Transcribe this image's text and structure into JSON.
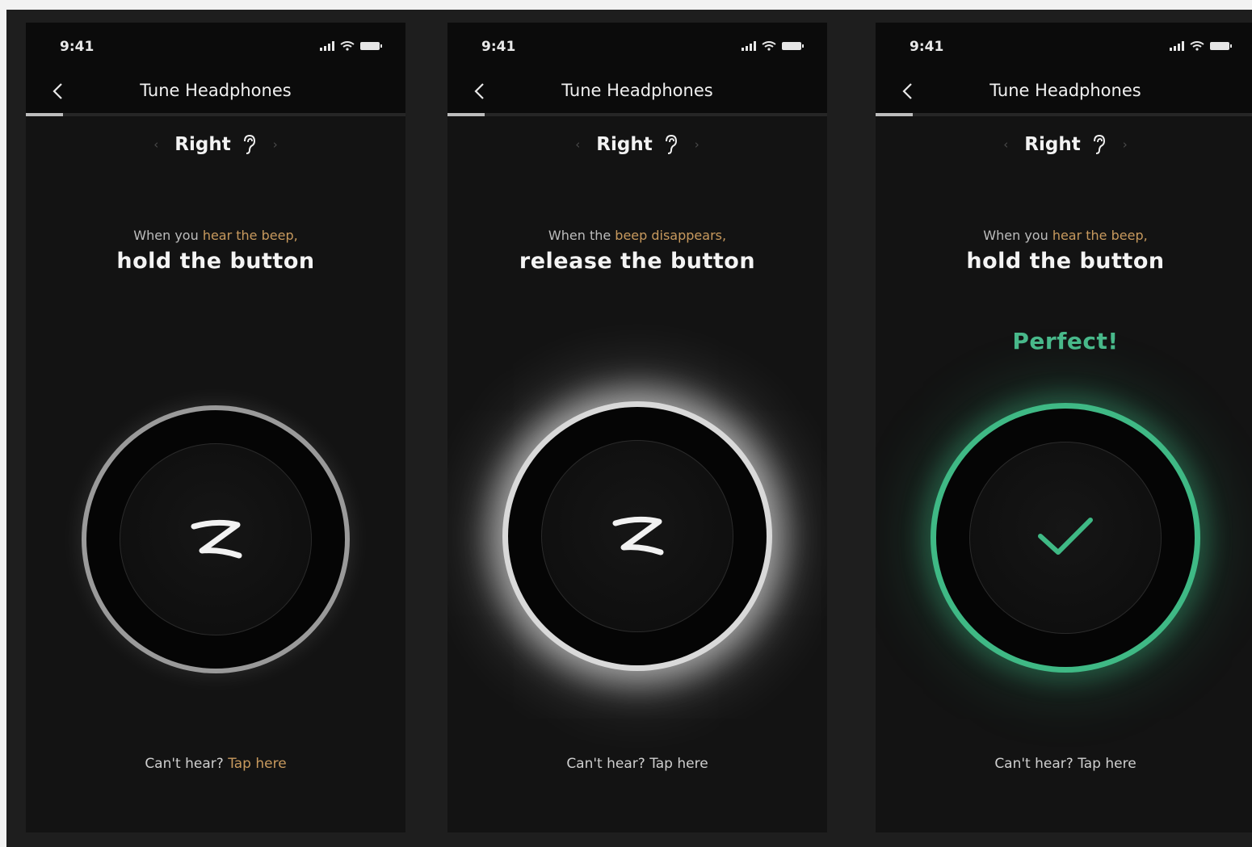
{
  "status_time": "9:41",
  "nav": {
    "title": "Tune Headphones"
  },
  "ear_selector": {
    "label": "Right"
  },
  "screens": [
    {
      "instruction_prefix": "When you ",
      "instruction_highlight": "hear the beep,",
      "instruction_main": "hold the button",
      "help_prefix": "Can't hear? ",
      "help_link": "Tap here",
      "state": "idle"
    },
    {
      "instruction_prefix": "When the ",
      "instruction_highlight": "beep disappears,",
      "instruction_main": "release the button",
      "help_prefix": "Can't hear? ",
      "help_link": "Tap here",
      "state": "holding"
    },
    {
      "instruction_prefix": "When you ",
      "instruction_highlight": "hear the beep,",
      "instruction_main": "hold the button",
      "feedback": "Perfect!",
      "help_prefix": "Can't hear? ",
      "help_link": "Tap here",
      "state": "success"
    }
  ],
  "colors": {
    "accent_gold": "#c89a5e",
    "success_green": "#49b98b",
    "background": "#131313"
  },
  "icons": [
    "back-chevron-icon",
    "ear-icon",
    "z-logo-icon",
    "checkmark-icon",
    "signal-icon",
    "wifi-icon",
    "battery-icon"
  ]
}
